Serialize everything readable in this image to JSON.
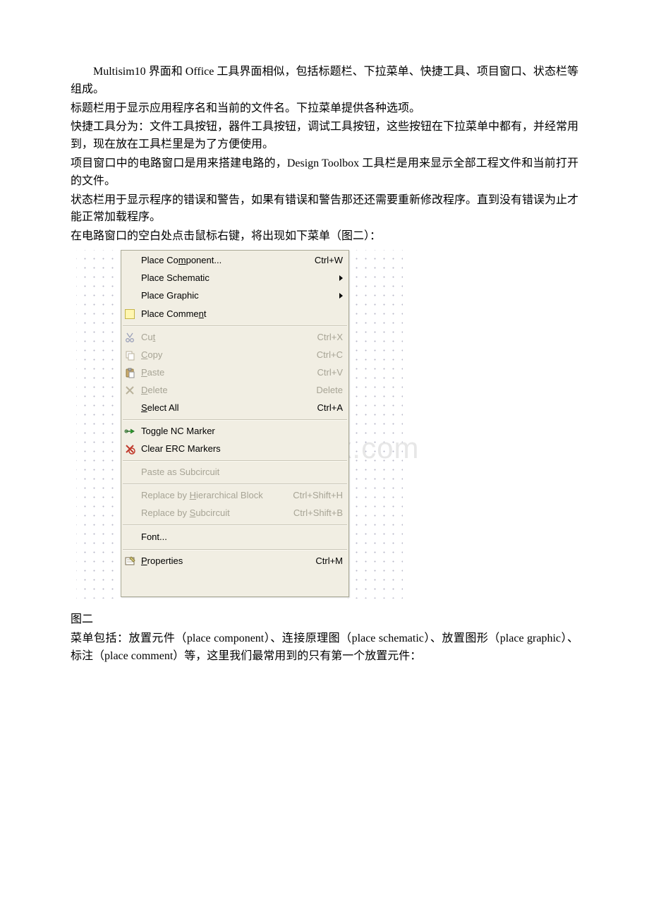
{
  "text": {
    "p1": "Multisim10 界面和 Office 工具界面相似，包括标题栏、下拉菜单、快捷工具、项目窗口、状态栏等组成。",
    "p2": "标题栏用于显示应用程序名和当前的文件名。下拉菜单提供各种选项。",
    "p3": "快捷工具分为：文件工具按钮，器件工具按钮，调试工具按钮，这些按钮在下拉菜单中都有，并经常用到，现在放在工具栏里是为了方便使用。",
    "p4": "项目窗口中的电路窗口是用来搭建电路的，Design Toolbox 工具栏是用来显示全部工程文件和当前打开的文件。",
    "p5": "状态栏用于显示程序的错误和警告，如果有错误和警告那还还需要重新修改程序。直到没有错误为止才能正常加载程序。",
    "p6": "在电路窗口的空白处点击鼠标右键，将出现如下菜单（图二）：",
    "caption": "图二",
    "p7": "菜单包括：放置元件（place component）、连接原理图（place schematic）、放置图形（place graphic）、标注（place comment）等，这里我们最常用到的只有第一个放置元件："
  },
  "watermark": "www.bdocx.com",
  "menu": {
    "place_component": "Place Component...",
    "place_component_key": "Ctrl+W",
    "place_schematic": "Place Schematic",
    "place_graphic": "Place Graphic",
    "place_comment": "Place Comment",
    "cut": "Cut",
    "cut_key": "Ctrl+X",
    "copy": "Copy",
    "copy_key": "Ctrl+C",
    "paste": "Paste",
    "paste_key": "Ctrl+V",
    "delete": "Delete",
    "delete_key": "Delete",
    "select_all": "Select All",
    "select_all_key": "Ctrl+A",
    "toggle_nc": "Toggle NC Marker",
    "clear_erc": "Clear ERC Markers",
    "paste_sub": "Paste as Subcircuit",
    "rep_hier": "Replace by Hierarchical Block",
    "rep_hier_key": "Ctrl+Shift+H",
    "rep_sub": "Replace by Subcircuit",
    "rep_sub_key": "Ctrl+Shift+B",
    "font": "Font...",
    "properties": "Properties",
    "properties_key": "Ctrl+M"
  }
}
